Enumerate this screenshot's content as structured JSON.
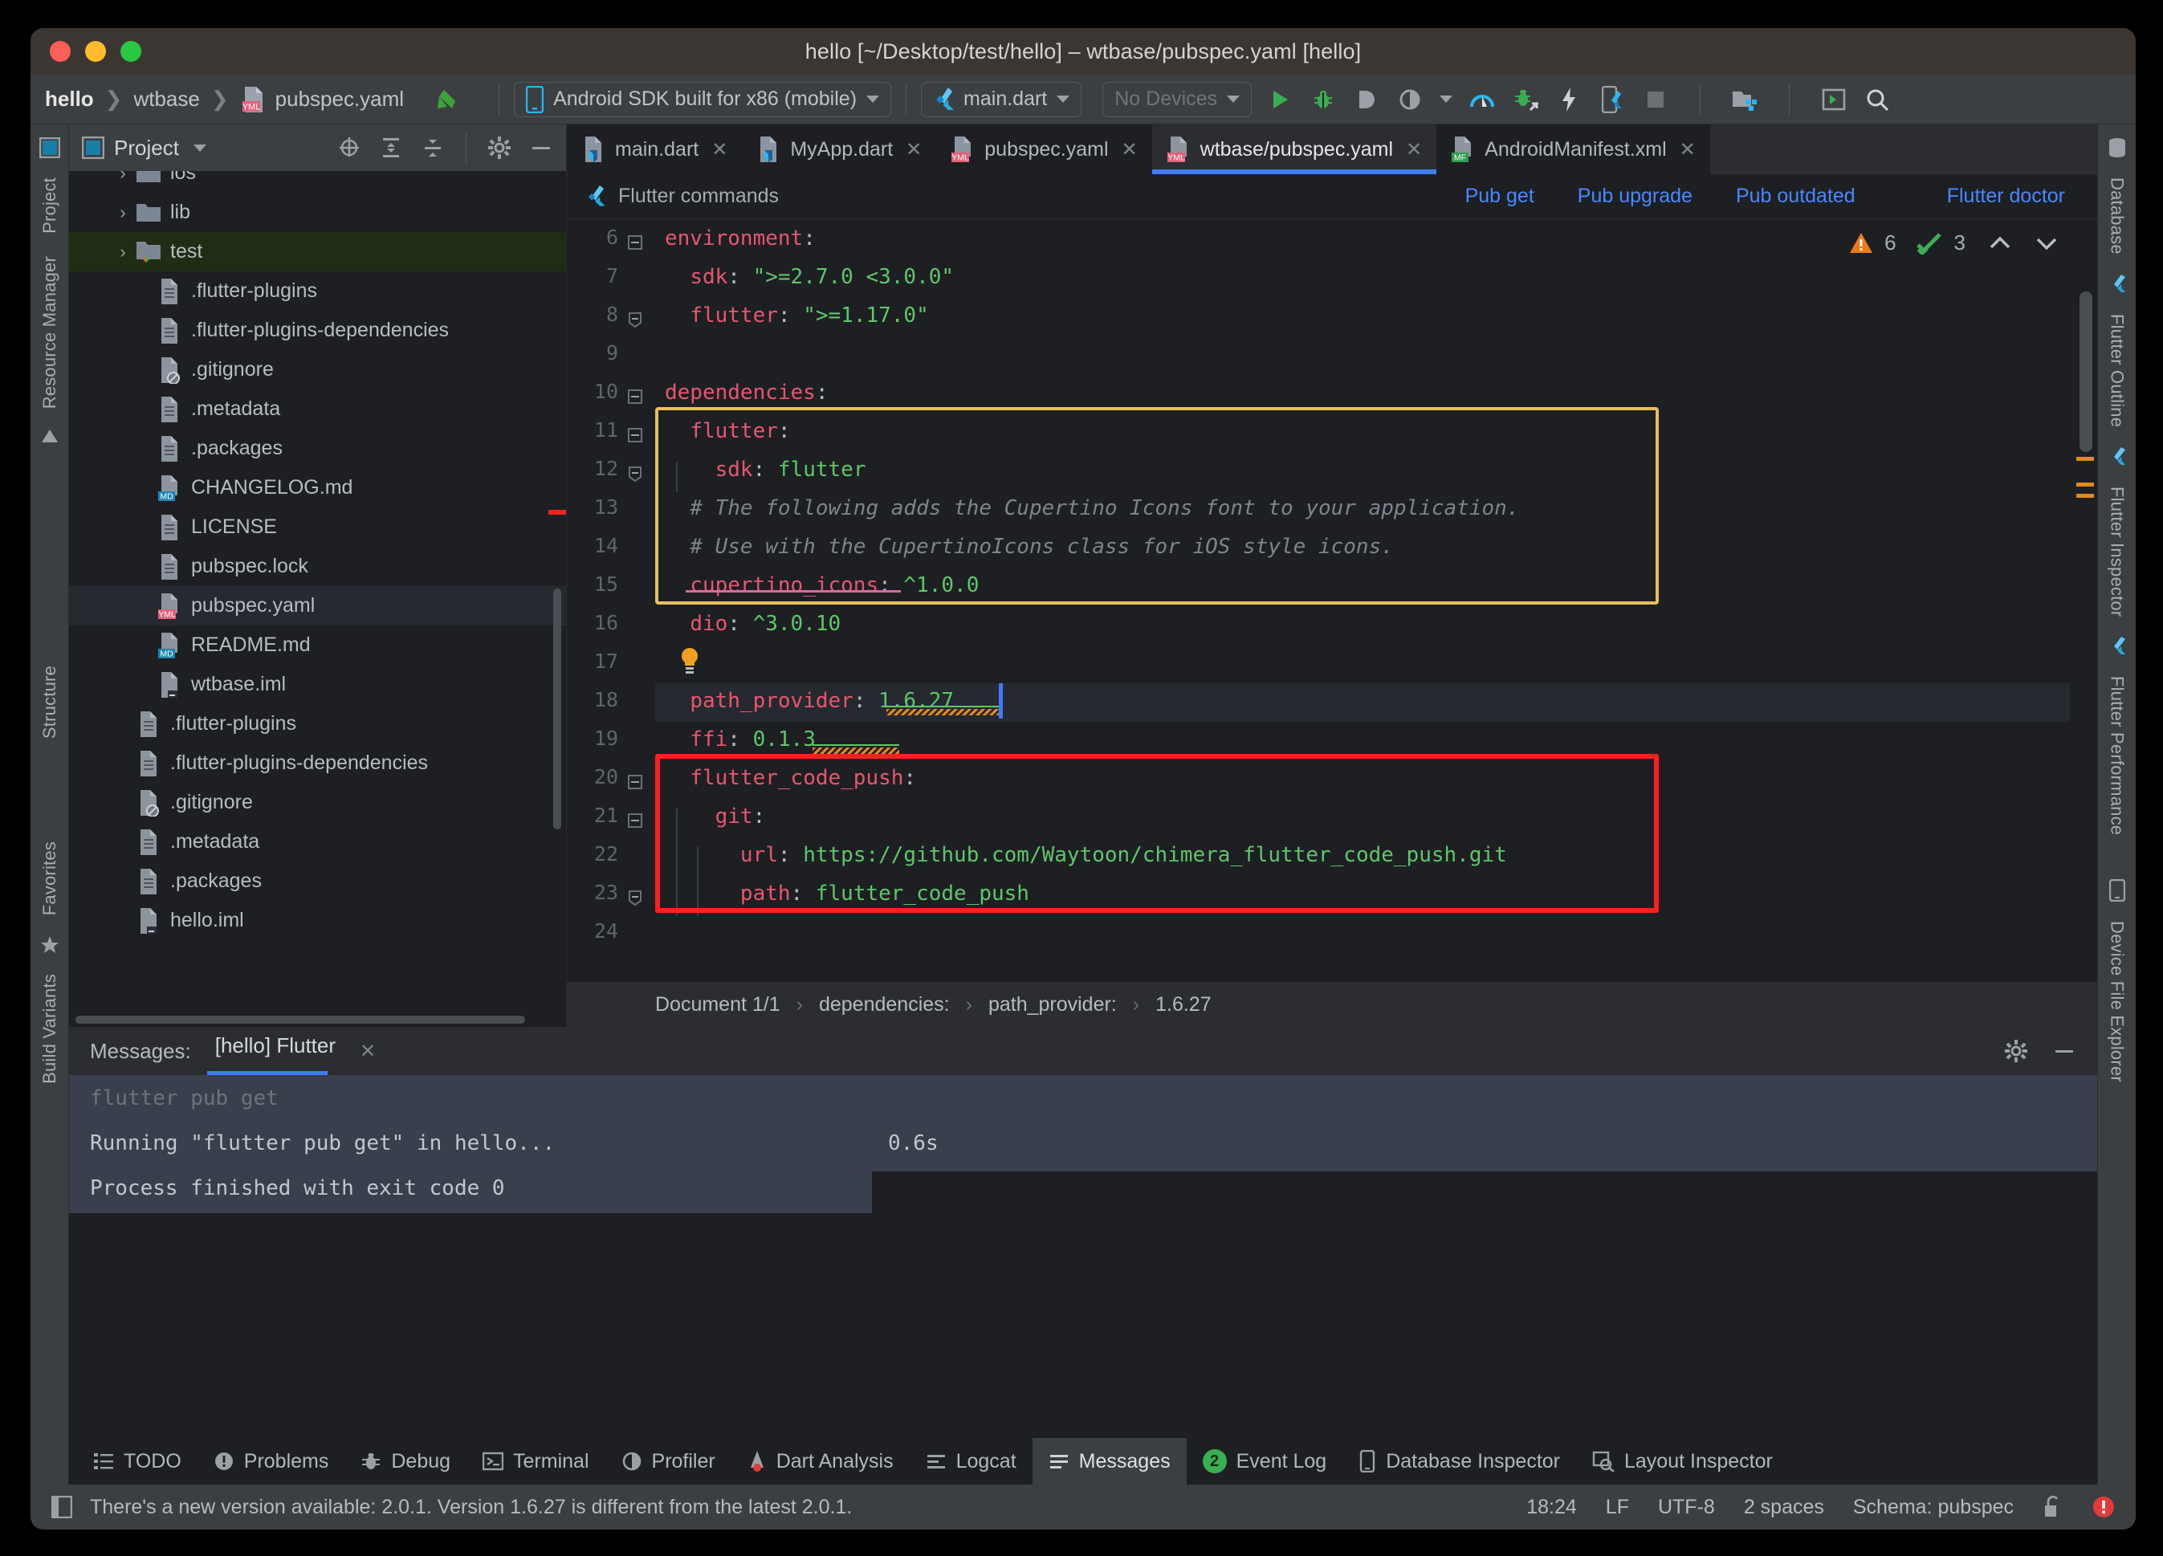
{
  "window": {
    "title": "hello [~/Desktop/test/hello] – wtbase/pubspec.yaml [hello]"
  },
  "navbar": {
    "breadcrumbs": [
      "hello",
      "wtbase",
      "pubspec.yaml"
    ],
    "device_selector": "Android SDK built for x86 (mobile)",
    "run_config": "main.dart",
    "devices": "No Devices",
    "icons": [
      "run-icon",
      "debug-icon",
      "profile-icon",
      "coverage-icon",
      "dropdown-caret-icon",
      "flutter-inspector-icon",
      "attach-debugger-icon",
      "hot-reload-icon",
      "device-flutter-icon",
      "stop-icon",
      "project-structure-icon",
      "open-terminal-icon",
      "search-everywhere-icon"
    ]
  },
  "left_rail": {
    "tabs": [
      "Project",
      "Resource Manager",
      "Structure",
      "Favorites",
      "Build Variants"
    ]
  },
  "right_rail": {
    "tabs": [
      "Database",
      "Flutter Outline",
      "Flutter Inspector",
      "Flutter Performance",
      "Device File Explorer"
    ]
  },
  "project_panel": {
    "title": "Project",
    "icons": [
      "locate-icon",
      "expand-all-icon",
      "collapse-all-icon",
      "settings-gear-icon",
      "hide-icon"
    ],
    "tree": [
      {
        "label": "ios",
        "type": "folder",
        "depth": 2,
        "expandable": true,
        "state": "clipped"
      },
      {
        "label": "lib",
        "type": "folder",
        "depth": 2,
        "expandable": true
      },
      {
        "label": "test",
        "type": "folder-test",
        "depth": 2,
        "expandable": true,
        "selected": "green"
      },
      {
        "label": ".flutter-plugins",
        "type": "file",
        "depth": 3
      },
      {
        "label": ".flutter-plugins-dependencies",
        "type": "file",
        "depth": 3
      },
      {
        "label": ".gitignore",
        "type": "file-ignore",
        "depth": 3
      },
      {
        "label": ".metadata",
        "type": "file",
        "depth": 3
      },
      {
        "label": ".packages",
        "type": "file",
        "depth": 3
      },
      {
        "label": "CHANGELOG.md",
        "type": "file-md",
        "depth": 3
      },
      {
        "label": "LICENSE",
        "type": "file",
        "depth": 3
      },
      {
        "label": "pubspec.lock",
        "type": "file",
        "depth": 3
      },
      {
        "label": "pubspec.yaml",
        "type": "file-yml",
        "depth": 3,
        "selected": "blue"
      },
      {
        "label": "README.md",
        "type": "file-md",
        "depth": 3
      },
      {
        "label": "wtbase.iml",
        "type": "file-iml",
        "depth": 3
      },
      {
        "label": ".flutter-plugins",
        "type": "file",
        "depth": 2
      },
      {
        "label": ".flutter-plugins-dependencies",
        "type": "file",
        "depth": 2
      },
      {
        "label": ".gitignore",
        "type": "file-ignore",
        "depth": 2
      },
      {
        "label": ".metadata",
        "type": "file",
        "depth": 2
      },
      {
        "label": ".packages",
        "type": "file",
        "depth": 2
      },
      {
        "label": "hello.iml",
        "type": "file-iml",
        "depth": 2
      }
    ]
  },
  "editor": {
    "tabs": [
      {
        "label": "main.dart",
        "icon": "dart-file-icon",
        "active": false
      },
      {
        "label": "MyApp.dart",
        "icon": "dart-file-icon",
        "active": false
      },
      {
        "label": "pubspec.yaml",
        "icon": "yml-file-icon",
        "active": false
      },
      {
        "label": "wtbase/pubspec.yaml",
        "icon": "yml-file-icon",
        "active": true
      },
      {
        "label": "AndroidManifest.xml",
        "icon": "mf-file-icon",
        "active": false
      }
    ],
    "flutter_commands": {
      "label": "Flutter commands",
      "links": [
        "Pub get",
        "Pub upgrade",
        "Pub outdated"
      ],
      "doctor": "Flutter doctor"
    },
    "inspections": {
      "warning_count": "6",
      "ok_count": "3"
    },
    "lines": [
      {
        "n": "6",
        "text": "environment:",
        "fold": "expanded"
      },
      {
        "n": "7",
        "text": "  sdk: \">=2.7.0 <3.0.0\""
      },
      {
        "n": "8",
        "text": "  flutter: \">=1.17.0\"",
        "fold": "end"
      },
      {
        "n": "9",
        "text": ""
      },
      {
        "n": "10",
        "text": "dependencies:",
        "fold": "expanded"
      },
      {
        "n": "11",
        "text": "  flutter:",
        "fold": "expanded"
      },
      {
        "n": "12",
        "text": "    sdk: flutter",
        "fold": "end"
      },
      {
        "n": "13",
        "text": "  # The following adds the Cupertino Icons font to your application."
      },
      {
        "n": "14",
        "text": "  # Use with the CupertinoIcons class for iOS style icons."
      },
      {
        "n": "15",
        "text": "  cupertino_icons: ^1.0.0"
      },
      {
        "n": "16",
        "text": "  dio: ^3.0.10"
      },
      {
        "n": "17",
        "text": ""
      },
      {
        "n": "18",
        "text": "  path_provider: 1.6.27"
      },
      {
        "n": "19",
        "text": "  ffi: 0.1.3"
      },
      {
        "n": "20",
        "text": "  flutter_code_push:",
        "fold": "expanded"
      },
      {
        "n": "21",
        "text": "    git:",
        "fold": "expanded"
      },
      {
        "n": "22",
        "text": "      url: https://github.com/Waytoon/chimera_flutter_code_push.git"
      },
      {
        "n": "23",
        "text": "      path: flutter_code_push",
        "fold": "end"
      },
      {
        "n": "24",
        "text": ""
      }
    ],
    "annotations": {
      "yellow_box_lines": "11-15",
      "red_box_lines": "20-23",
      "bulb_line": "17",
      "cursor_line": "18",
      "cursor_after": "1.6.27"
    },
    "breadcrumb": [
      "Document 1/1",
      "dependencies:",
      "path_provider:",
      "1.6.27"
    ]
  },
  "messages_panel": {
    "label": "Messages:",
    "tab": "[hello] Flutter",
    "icons": [
      "settings-gear-icon",
      "hide-icon"
    ],
    "output": [
      {
        "text": "flutter pub get",
        "style": "dim"
      },
      {
        "text": "Running \"flutter pub get\" in hello...",
        "style": "normal",
        "duration": "0.6s"
      },
      {
        "text": "Process finished with exit code 0",
        "style": "normal"
      }
    ]
  },
  "bottom_toolbar": {
    "items": [
      {
        "label": "TODO",
        "icon": "todo-icon",
        "active": false
      },
      {
        "label": "Problems",
        "icon": "problems-icon",
        "active": false
      },
      {
        "label": "Debug",
        "icon": "debug-bug-icon",
        "active": false
      },
      {
        "label": "Terminal",
        "icon": "terminal-icon",
        "active": false
      },
      {
        "label": "Profiler",
        "icon": "profiler-icon",
        "active": false
      },
      {
        "label": "Dart Analysis",
        "icon": "dart-analysis-icon",
        "active": false
      },
      {
        "label": "Logcat",
        "icon": "logcat-icon",
        "active": false
      },
      {
        "label": "Messages",
        "icon": "messages-icon",
        "active": true
      },
      {
        "label": "Event Log",
        "icon": "event-log-badge",
        "badge": "2",
        "active": false
      },
      {
        "label": "Database Inspector",
        "icon": "database-inspector-icon",
        "active": false
      },
      {
        "label": "Layout Inspector",
        "icon": "layout-inspector-icon",
        "active": false
      }
    ]
  },
  "statusbar": {
    "message": "There's a new version available: 2.0.1. Version 1.6.27 is different from the latest 2.0.1.",
    "time": "18:24",
    "line_sep": "LF",
    "encoding": "UTF-8",
    "indent": "2 spaces",
    "schema": "Schema: pubspec",
    "icons": [
      "unlock-icon",
      "error-icon"
    ]
  },
  "colors": {
    "accent_blue": "#3f7bff",
    "link_blue": "#4a88ff",
    "key_red": "#e8566f",
    "value_green": "#5ec76a",
    "warning_orange": "#e08a1e",
    "highlight_yellow": "#e8c05a",
    "highlight_red": "#ff2020"
  }
}
